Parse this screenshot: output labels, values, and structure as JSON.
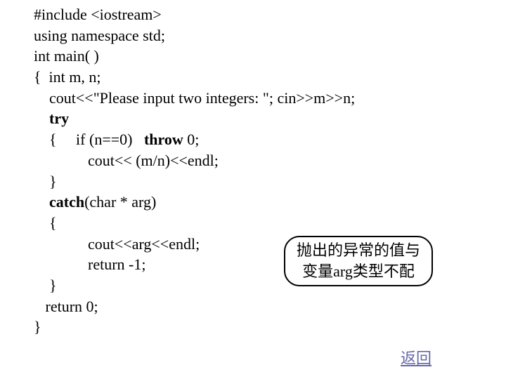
{
  "code": {
    "l1": "#include <iostream>",
    "l2": "using namespace std;",
    "l3": "int main( )",
    "l4": "{  int m, n;",
    "l5a": "    cout<<\"Please input two integers: \"; cin>>m>>n;",
    "l6_pre": "    ",
    "l6_kw": "try",
    "l7_pre": "    {     if (n==0)   ",
    "l7_kw": "throw",
    "l7_post": " 0;",
    "l8": "              cout<< (m/n)<<endl;",
    "l9": "    }",
    "l10_pre": "    ",
    "l10_kw": "catch",
    "l10_post": "(char * arg)",
    "l11": "    {",
    "l12": "              cout<<arg<<endl;",
    "l13": "              return -1;",
    "l14": "    }",
    "l15": "   return 0;",
    "l16": "}"
  },
  "callout": {
    "line1": "抛出的异常的值与",
    "line2": "变量arg类型不配"
  },
  "returnLink": "返回"
}
